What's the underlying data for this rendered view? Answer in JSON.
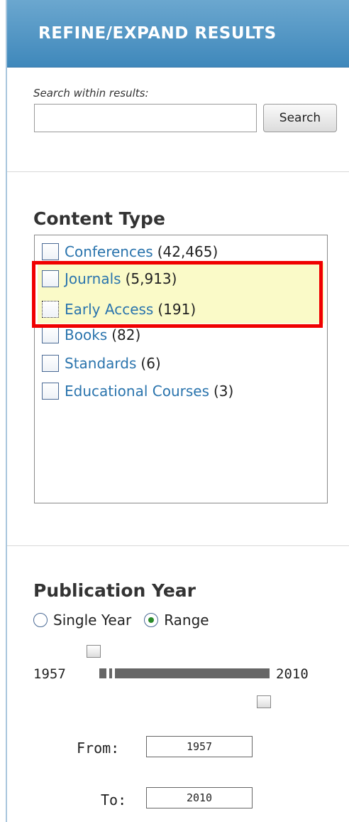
{
  "header": {
    "title": "REFINE/EXPAND RESULTS"
  },
  "search_within": {
    "label": "Search within results:",
    "input_value": "",
    "button_label": "Search"
  },
  "content_type": {
    "title": "Content Type",
    "items": [
      {
        "label": "Conferences",
        "count": "(42,465)",
        "checked": false
      },
      {
        "label": "Journals",
        "count": "(5,913)",
        "checked": false
      },
      {
        "label": "Early Access",
        "count": "(191)",
        "checked": false
      },
      {
        "label": "Books",
        "count": "(82)",
        "checked": false
      },
      {
        "label": "Standards",
        "count": "(6)",
        "checked": false
      },
      {
        "label": "Educational Courses",
        "count": "(3)",
        "checked": false
      }
    ]
  },
  "publication_year": {
    "title": "Publication Year",
    "mode_options": [
      "Single Year",
      "Range"
    ],
    "selected_mode": "Range",
    "range_min": "1957",
    "range_max": "2010",
    "from_label": "From:",
    "from_value": "1957",
    "to_label": "To:",
    "to_value": "2010"
  },
  "colors": {
    "header_bg": "#4a92c4",
    "link": "#2a74ad",
    "highlight": "#fafac8",
    "annotation_box": "#f00000"
  }
}
